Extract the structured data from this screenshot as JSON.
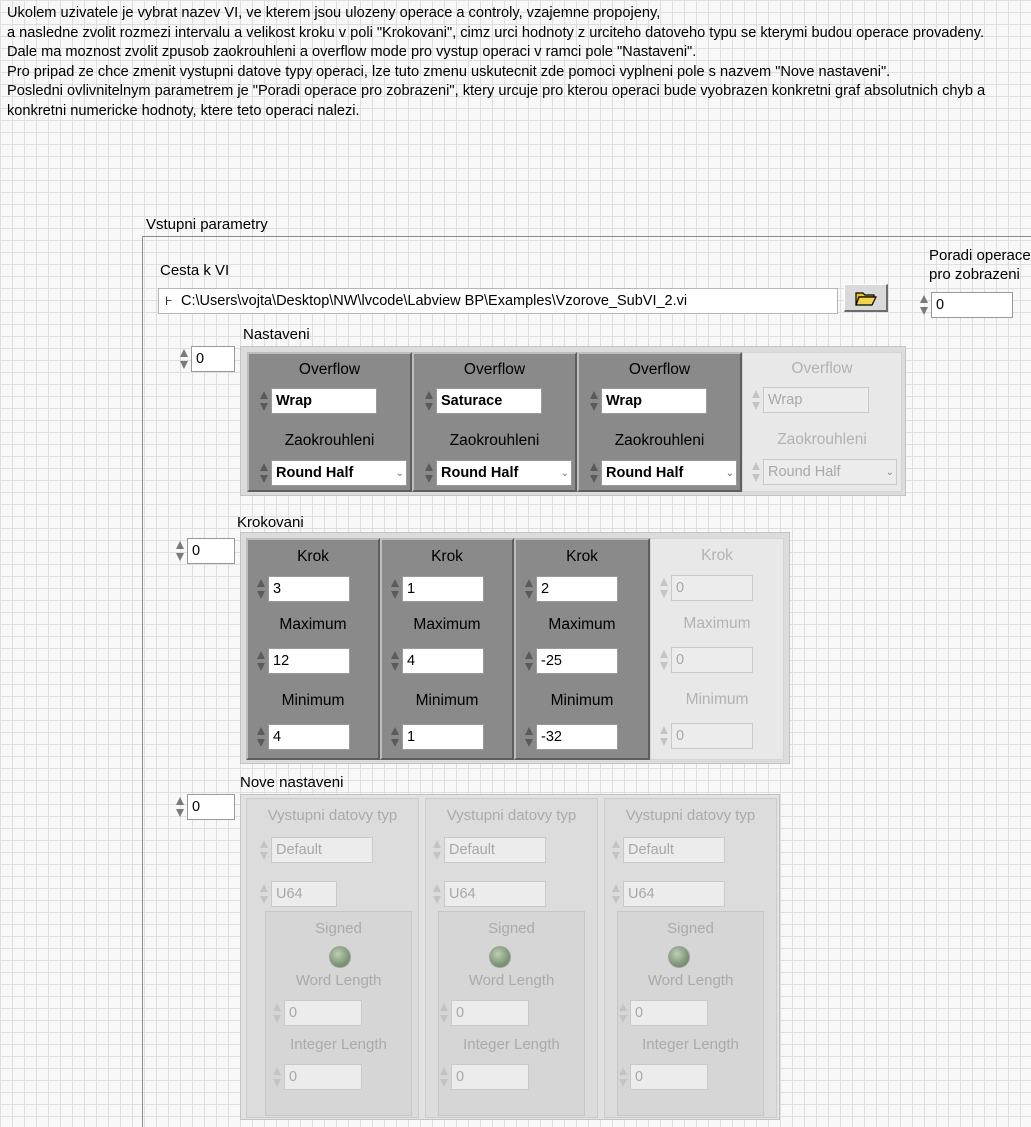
{
  "description": "Ukolem uzivatele je vybrat nazev VI, ve kterem jsou ulozeny operace a controly, vzajemne propojeny,\na nasledne zvolit rozmezi intervalu a velikost kroku v poli \"Krokovani\", cimz urci hodnoty z urciteho datoveho typu se kterymi budou operace provadeny.\nDale ma moznost zvolit zpusob zaokrouhleni a overflow mode pro vystup operaci v ramci pole \"Nastaveni\".\nPro pripad ze chce zmenit vystupni datove typy operaci, lze tuto zmenu uskutecnit zde pomoci vyplneni pole s nazvem \"Nove nastaveni\".\nPosledni ovlivnitelnym parametrem je \"Poradi operace pro zobrazeni\", ktery urcuje pro kterou operaci bude vyobrazen konkretni graf absolutnich chyb a konkretni numericke hodnoty, ktere teto operaci nalezi.",
  "vstupni_label": "Vstupni parametry",
  "cesta": {
    "label": "Cesta k VI",
    "value": "C:\\Users\\vojta\\Desktop\\NW\\lvcode\\Labview BP\\Examples\\Vzorove_SubVI_2.vi"
  },
  "poradi": {
    "label_line1": "Poradi operace",
    "label_line2": "pro zobrazeni",
    "value": "0"
  },
  "nastaveni": {
    "label": "Nastaveni",
    "index": "0",
    "overflow_label": "Overflow",
    "zaokrouhleni_label": "Zaokrouhleni",
    "elements": [
      {
        "overflow": "Wrap",
        "zaokrouhleni": "Round Half",
        "enabled": true
      },
      {
        "overflow": "Saturace",
        "zaokrouhleni": "Round Half",
        "enabled": true
      },
      {
        "overflow": "Wrap",
        "zaokrouhleni": "Round Half",
        "enabled": true
      },
      {
        "overflow": "Wrap",
        "zaokrouhleni": "Round Half",
        "enabled": false
      }
    ]
  },
  "krokovani": {
    "label": "Krokovani",
    "index": "0",
    "krok_label": "Krok",
    "maximum_label": "Maximum",
    "minimum_label": "Minimum",
    "elements": [
      {
        "krok": "3",
        "maximum": "12",
        "minimum": "4",
        "enabled": true
      },
      {
        "krok": "1",
        "maximum": "4",
        "minimum": "1",
        "enabled": true
      },
      {
        "krok": "2",
        "maximum": "-25",
        "minimum": "-32",
        "enabled": true
      },
      {
        "krok": "0",
        "maximum": "0",
        "minimum": "0",
        "enabled": false
      }
    ]
  },
  "nove_nastaveni": {
    "label": "Nove nastaveni",
    "index": "0",
    "typ_label": "Vystupni datovy typ",
    "signed_label": "Signed",
    "word_length_label": "Word Length",
    "integer_length_label": "Integer Length",
    "elements": [
      {
        "typ": "Default",
        "rep": "U64",
        "word_length": "0",
        "integer_length": "0"
      },
      {
        "typ": "Default",
        "rep": "U64",
        "word_length": "0",
        "integer_length": "0"
      },
      {
        "typ": "Default",
        "rep": "U64",
        "word_length": "0",
        "integer_length": "0"
      }
    ]
  },
  "icons": {
    "browse": "folder-open-icon",
    "path": "path-icon",
    "increment": "spin-arrows-icon",
    "signed": "led-icon"
  }
}
